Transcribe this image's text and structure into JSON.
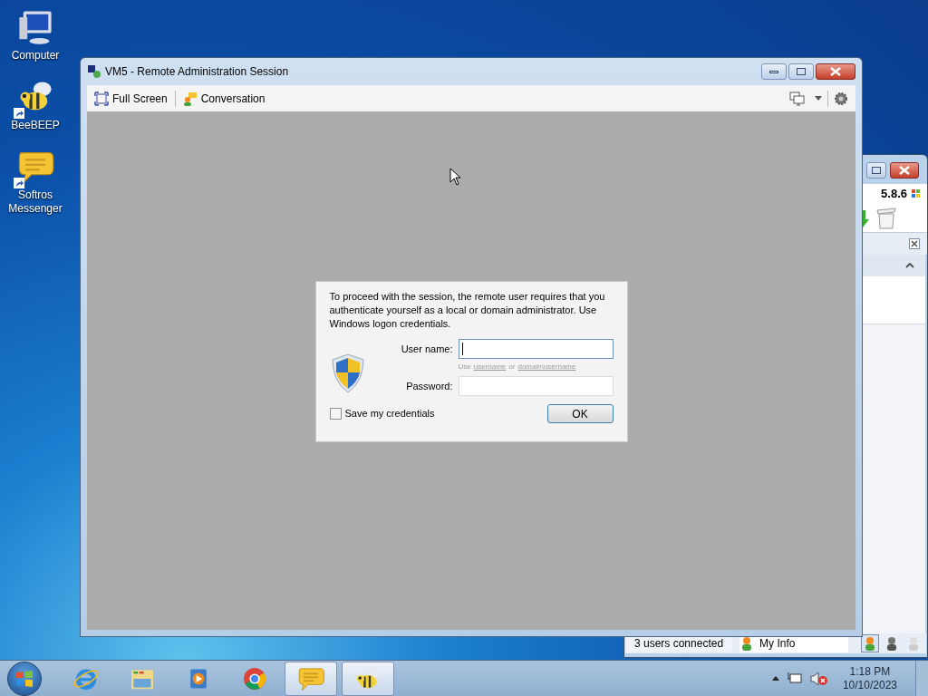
{
  "desktop_icons": [
    {
      "label": "Computer",
      "kind": "computer"
    },
    {
      "label": "BeeBEEP",
      "kind": "bee"
    },
    {
      "label": "Softros Messenger",
      "kind": "chat"
    }
  ],
  "back_window": {
    "version": "5.8.6",
    "status": "3 users connected",
    "my_info": "My Info",
    "user_states": [
      {
        "selected": true
      },
      {
        "selected": false
      },
      {
        "selected": false
      }
    ]
  },
  "main_window": {
    "title": "VM5 - Remote Administration Session",
    "toolbar": [
      {
        "label": "Full Screen",
        "kind": "fullscreen"
      },
      {
        "label": "Conversation",
        "kind": "conversation"
      }
    ]
  },
  "dialog": {
    "message": "To proceed with the session, the remote user requires that you authenticate yourself as a local or domain administrator. Use Windows logon credentials.",
    "username_label": "User name:",
    "username_focused": true,
    "hint": [
      {
        "text": "Use",
        "kind": "plain"
      },
      {
        "text": "username",
        "kind": "link"
      },
      {
        "text": "or",
        "kind": "plain"
      },
      {
        "text": "domain\\username",
        "kind": "link"
      }
    ],
    "password_label": "Password:",
    "save_credentials": {
      "label": "Save my credentials",
      "checked": false
    },
    "ok": "OK"
  },
  "taskbar": {
    "apps": [
      {
        "kind": "ie",
        "open": false
      },
      {
        "kind": "explorer",
        "open": false
      },
      {
        "kind": "media",
        "open": false
      },
      {
        "kind": "chrome",
        "open": false
      },
      {
        "kind": "chat",
        "open": true
      },
      {
        "kind": "bee",
        "open": true
      }
    ],
    "time": "1:18 PM",
    "date": "10/10/2023"
  }
}
